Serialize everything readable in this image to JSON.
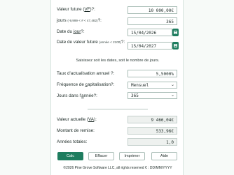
{
  "labels": {
    "future_value_pre": "Valeur future (",
    "future_value_key": "VF",
    "future_value_post": ")?:",
    "days": "jours",
    "days_note": "(-9,999 < # < 47,482)",
    "days_post": "?:",
    "current_date_pre": "Date du ",
    "current_date_key": "jour",
    "current_date_post": "?:",
    "future_date": "Date de valeur future",
    "future_date_note": "(année < 2100)",
    "future_date_post": "?:",
    "hint": "Saisissez soit les dates, soit le nombre de jours.",
    "rate": "Taux d'actualisation annuel ?:",
    "frequency_pre": "Fréquence de ",
    "frequency_key": "c",
    "frequency_post": "apitalisation?:",
    "days_per_year_pre": "Jours dans l'",
    "days_per_year_key": "a",
    "days_per_year_post": "nnée?:",
    "present_value_pre": "Valeur actuelle (",
    "present_value_key": "VA",
    "present_value_post": "):",
    "discount": "Montant de remise:",
    "years": "Années totales:"
  },
  "values": {
    "future_value": "10 000,00€",
    "days": "365",
    "current_date": "15/04/2026",
    "future_date": "15/04/2027",
    "rate": "5,5000%",
    "frequency": "Mensuel",
    "days_per_year": "365",
    "present_value": "9 466,04€",
    "discount": "533,96€",
    "years": "1,0"
  },
  "buttons": {
    "calc": "Calc",
    "clear": "Effacer",
    "print": "Imprimer",
    "help": "Aide"
  },
  "footer": "©2026 Pine Grove Software LLC, all rights reserved  € : DD/MM/YYYY",
  "icons": {
    "calendar": "calendar-icon",
    "dropdown": "chevron-down-icon"
  },
  "colors": {
    "accent": "#1e7d5f"
  }
}
